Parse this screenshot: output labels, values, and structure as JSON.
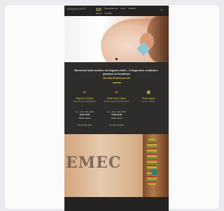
{
  "header": {
    "logo": "MANARA ARTE",
    "nav_top": [
      "Home",
      "Presentazione",
      "Corsi",
      "Galleria"
    ],
    "nav_bottom": [
      "Eventi",
      "Contatti"
    ],
    "menu_icon": "hamburger-icon"
  },
  "intro": {
    "title": "Benvenuti nella scuola e nel negozio d'arte – il luogo dove creatività e passione si incontrano",
    "subtitle": "Da oltre 25 anni con voi"
  },
  "locations": [
    {
      "icon": "map-pin-icon",
      "title": "Negozio in Roma",
      "text": "Via Cavour 112\n00184 Roma"
    },
    {
      "icon": "map-pin-icon",
      "title": "Sede Roma Talenti",
      "text": "Via Ugo Ojetti 234\n00137 Roma"
    },
    {
      "icon": "eye-icon",
      "title": "Orari negozio",
      "text": "Lunedì – Sabato"
    }
  ],
  "hours": [
    {
      "days": "Lun – Ven: 9:30–13:00",
      "highlight": "15:30–19:30",
      "note": "Sabato mattina"
    },
    {
      "days": "Lun – Ven: 9:30–13:00",
      "highlight": "15:30–19:30",
      "note": "Sabato chiuso"
    }
  ],
  "phones": [
    "Tel: 06 4825 0119",
    "Tel: 06 8719 2261"
  ],
  "photo_caption": "EMEC",
  "colors": {
    "accent": "#e2c44b",
    "site_bg": "#2e2d2b"
  }
}
